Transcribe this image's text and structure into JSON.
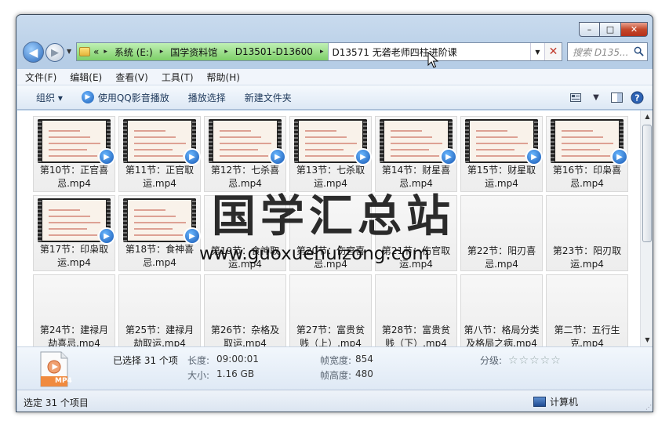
{
  "window": {
    "min": "–",
    "max": "□",
    "close": "✕"
  },
  "nav": {
    "back": "◀",
    "forward": "▶",
    "dropdown": "▼"
  },
  "address": {
    "overflow": "«",
    "crumbs": [
      "系统 (E:)",
      "国学资料馆",
      "D13501-D13600"
    ],
    "separator": "▸",
    "current": "D13571 无砻老师四柱进阶课",
    "dropdown": "▼",
    "clear": "✕"
  },
  "search": {
    "placeholder": "搜索 D135..."
  },
  "menu": [
    "文件(F)",
    "编辑(E)",
    "查看(V)",
    "工具(T)",
    "帮助(H)"
  ],
  "commands": {
    "organize": "组织 ▾",
    "play_qq": "使用QQ影音播放",
    "play_selection": "播放选择",
    "new_folder": "新建文件夹"
  },
  "files": [
    {
      "name": "第10节：正官喜忌.mp4",
      "thumb": true
    },
    {
      "name": "第11节：正官取运.mp4",
      "thumb": true
    },
    {
      "name": "第12节：七杀喜忌.mp4",
      "thumb": true
    },
    {
      "name": "第13节：七杀取运.mp4",
      "thumb": true
    },
    {
      "name": "第14节：财星喜忌.mp4",
      "thumb": true
    },
    {
      "name": "第15节：财星取运.mp4",
      "thumb": true
    },
    {
      "name": "第16节：印枭喜忌.mp4",
      "thumb": true
    },
    {
      "name": "第17节：印枭取运.mp4",
      "thumb": true
    },
    {
      "name": "第18节：食神喜忌.mp4",
      "thumb": true
    },
    {
      "name": "第19节：食神取运.mp4",
      "thumb": false
    },
    {
      "name": "第20节：伤官喜忌.mp4",
      "thumb": false
    },
    {
      "name": "第21节：伤官取运.mp4",
      "thumb": false
    },
    {
      "name": "第22节：阳刃喜忌.mp4",
      "thumb": false
    },
    {
      "name": "第23节：阳刃取运.mp4",
      "thumb": false
    },
    {
      "name": "第24节：建禄月劫喜忌.mp4",
      "thumb": false
    },
    {
      "name": "第25节：建禄月劫取运.mp4",
      "thumb": false
    },
    {
      "name": "第26节：杂格及取运.mp4",
      "thumb": false
    },
    {
      "name": "第27节：富贵贫贱（上）.mp4",
      "thumb": false
    },
    {
      "name": "第28节：富贵贫贱（下）.mp4",
      "thumb": false
    },
    {
      "name": "第八节：格局分类及格局之病.mp4",
      "thumb": false
    },
    {
      "name": "第二节：五行生克.mp4",
      "thumb": false
    }
  ],
  "watermark": {
    "cn": "国学汇总站",
    "url": "www.guoxuehuizong.com"
  },
  "details": {
    "icon_label": "MP4",
    "selected": "已选择 31 个项",
    "length_k": "长度:",
    "length_v": "09:00:01",
    "size_k": "大小:",
    "size_v": "1.16 GB",
    "fw_k": "帧宽度:",
    "fw_v": "854",
    "fh_k": "帧高度:",
    "fh_v": "480",
    "rating_k": "分级:",
    "stars": "☆☆☆☆☆"
  },
  "status": {
    "left": "选定 31 个项目",
    "right": "计算机"
  }
}
